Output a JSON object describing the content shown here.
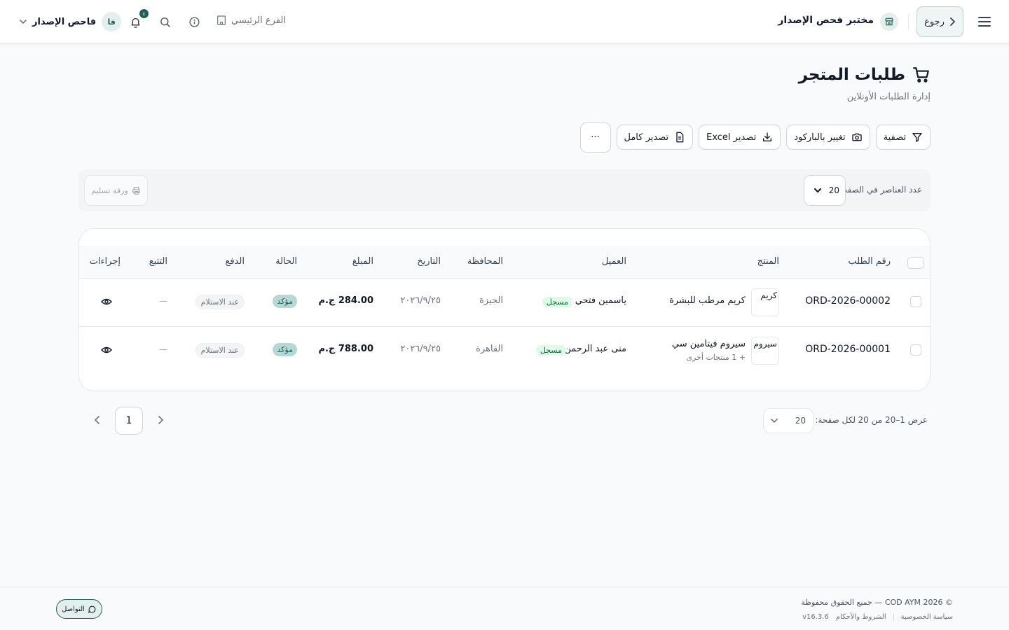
{
  "header": {
    "back_label": "رجوع",
    "store_name": "مختبر فحص الإصدار",
    "branch_label": "الفرع الرئيسي",
    "notification_count": "٤",
    "user_name": "فاحص الإصدار",
    "user_initials": "فا"
  },
  "page": {
    "title": "طلبات المتجر",
    "subtitle": "إدارة الطلبات الأونلاين"
  },
  "toolbar": {
    "filter_label": "تصفية",
    "barcode_label": "تغيير بالباركود",
    "export_excel_label": "تصدير Excel",
    "export_full_label": "تصدير كامل",
    "more_label": "···"
  },
  "filter_bar": {
    "per_page_label": "عدد العناصر في الصفحة:",
    "per_page_value": "20",
    "delivery_sheet_label": "ورقة تسليم"
  },
  "table": {
    "columns": {
      "order_id": "رقم الطلب",
      "product": "المنتج",
      "customer": "العميل",
      "governorate": "المحافظة",
      "date": "التاريخ",
      "amount": "المبلغ",
      "status": "الحالة",
      "payment": "الدفع",
      "tracking": "التتبع",
      "actions": "إجراءات"
    },
    "rows": [
      {
        "order_id": "ORD-2026-00002",
        "thumb_alt": "كريم",
        "product": "كريم مرطب للبشرة",
        "product_more": "",
        "customer": "ياسمين فتحي",
        "customer_badge": "مسجل",
        "governorate": "الجيزة",
        "date": "٢٠٢٦/٩/٢٥",
        "amount": "284.00 ج.م",
        "status": "مؤكد",
        "payment": "عند الاستلام",
        "tracking": "—"
      },
      {
        "order_id": "ORD-2026-00001",
        "thumb_alt": "سيروم",
        "product": "سيروم فيتامين سي",
        "product_more": "+ 1 منتجات أخرى",
        "customer": "منى عبد الرحمن",
        "customer_badge": "مسجل",
        "governorate": "القاهرة",
        "date": "٢٠٢٦/٩/٢٥",
        "amount": "788.00 ج.م",
        "status": "مؤكد",
        "payment": "عند الاستلام",
        "tracking": "—"
      }
    ]
  },
  "pagination": {
    "showing_text": "عرض 1–20 من 20",
    "per_page_label": "لكل صفحة:",
    "per_page_value": "20",
    "current_page": "1"
  },
  "footer": {
    "copyright": "© 2026 COD AYM — جميع الحقوق محفوظة",
    "privacy": "سياسة الخصوصية",
    "terms": "الشروط والأحكام",
    "version": "v16.3.6",
    "contact_label": "التواصل"
  },
  "colors": {
    "accent": "#1f5f58",
    "accent_light": "#e3efed",
    "registered_badge": "#dcfce7",
    "confirmed_badge": "#b6d8d4"
  },
  "icons": [
    "menu-icon",
    "chevron-right-icon",
    "store-icon",
    "building-icon",
    "info-icon",
    "search-icon",
    "bell-icon",
    "chevron-down-icon",
    "cart-icon",
    "filter-icon",
    "camera-icon",
    "download-icon",
    "file-icon",
    "printer-icon",
    "eye-icon",
    "chevron-left-icon",
    "chat-icon"
  ]
}
